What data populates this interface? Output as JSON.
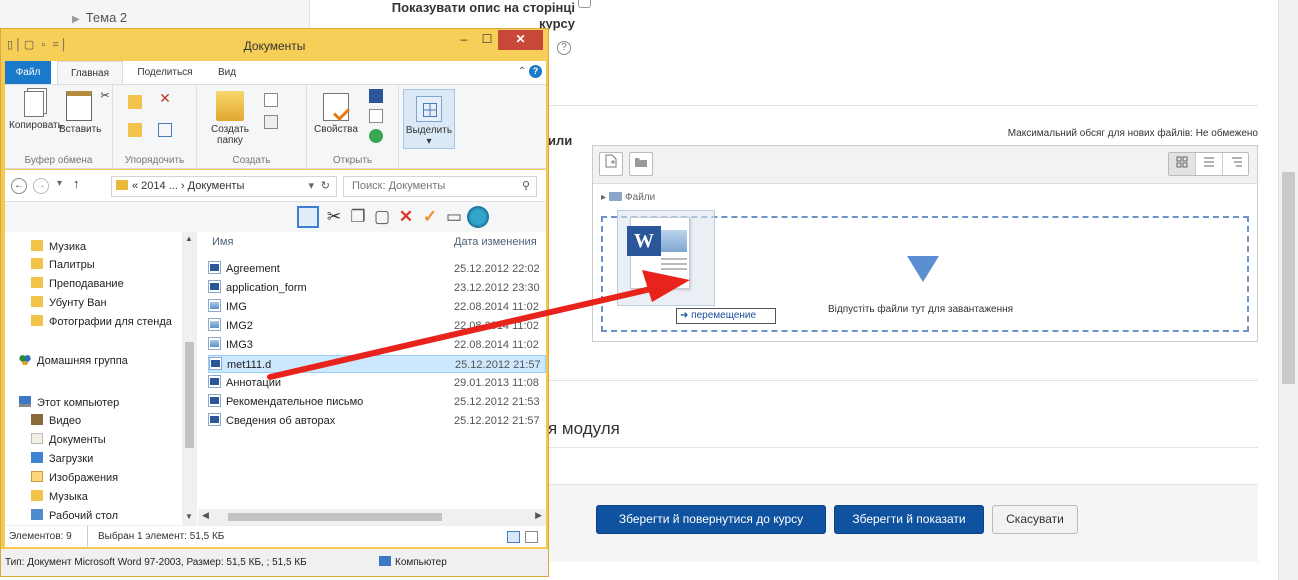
{
  "moodle": {
    "nav_topic": "Тема 2",
    "course_label_line1": "Показувати опис на сторінці",
    "course_label_line2": "курсу",
    "help_icon": "?",
    "files_label": "или",
    "max_size_text": "Максимальний обсяг для нових файлів: Не обмежено",
    "fm_path": "Файли",
    "drop_text": "Відпустіть файли тут для завантаження",
    "module_heading": "я модуля",
    "buttons": {
      "save_return": "Зберегти й повернутися до курсу",
      "save_show": "Зберегти й показати",
      "cancel": "Скасувати"
    }
  },
  "drag": {
    "tooltip": "перемещение",
    "icon": "word-document-icon"
  },
  "explorer": {
    "title": "Документы",
    "tabs": {
      "file": "Файл",
      "home": "Главная",
      "share": "Поделиться",
      "view": "Вид"
    },
    "help": "?",
    "ribbon": {
      "copy": "Копировать",
      "paste": "Вставить",
      "new_folder_1": "Создать",
      "new_folder_2": "папку",
      "properties": "Свойства",
      "select": "Выделить",
      "groups": {
        "clipboard": "Буфер обмена",
        "organize": "Упорядочить",
        "create": "Создать",
        "open": "Открыть"
      }
    },
    "address": {
      "path": "« 2014 ... › Документы",
      "search_placeholder": "Поиск: Документы"
    },
    "nav_pane": [
      {
        "label": "Музика",
        "icon": "ico-yel"
      },
      {
        "label": "Палитры",
        "icon": "ico-yel"
      },
      {
        "label": "Преподавание",
        "icon": "ico-yel"
      },
      {
        "label": "Убунту Ван",
        "icon": "ico-yel"
      },
      {
        "label": "Фотографии для стенда",
        "icon": "ico-yel"
      },
      {
        "label": "Домашняя группа",
        "icon": "ico-home"
      },
      {
        "label": "Этот компьютер",
        "icon": "ico-pc"
      },
      {
        "label": "Видео",
        "icon": "ico-video"
      },
      {
        "label": "Документы",
        "icon": "ico-docs"
      },
      {
        "label": "Загрузки",
        "icon": "ico-dl"
      },
      {
        "label": "Изображения",
        "icon": "ico-img"
      },
      {
        "label": "Музыка",
        "icon": "ico-music"
      },
      {
        "label": "Рабочий стол",
        "icon": "ico-desk"
      }
    ],
    "columns": {
      "name": "Имя",
      "date": "Дата изменения"
    },
    "files": [
      {
        "name": "Agreement",
        "date": "25.12.2012 22:02",
        "type": "doc",
        "selected": false
      },
      {
        "name": "application_form",
        "date": "23.12.2012 23:30",
        "type": "doc",
        "selected": false
      },
      {
        "name": "IMG",
        "date": "22.08.2014 11:02",
        "type": "img",
        "selected": false
      },
      {
        "name": "IMG2",
        "date": "22.08.2014 11:02",
        "type": "img",
        "selected": false
      },
      {
        "name": "IMG3",
        "date": "22.08.2014 11:02",
        "type": "img",
        "selected": false
      },
      {
        "name": "met111.d",
        "date": "25.12.2012 21:57",
        "type": "doc",
        "selected": true
      },
      {
        "name": "Аннотации",
        "date": "29.01.2013 11:08",
        "type": "doc",
        "selected": false
      },
      {
        "name": "Рекомендательное письмо",
        "date": "25.12.2012 21:53",
        "type": "doc",
        "selected": false
      },
      {
        "name": "Сведения об авторах",
        "date": "25.12.2012 21:57",
        "type": "doc",
        "selected": false
      }
    ],
    "status": {
      "count": "Элементов: 9",
      "selected": "Выбран 1 элемент: 51,5 КБ",
      "details": "Тип: Документ Microsoft Word 97-2003, Размер: 51,5 КБ, ; 51,5 КБ",
      "location": "Компьютер"
    }
  }
}
